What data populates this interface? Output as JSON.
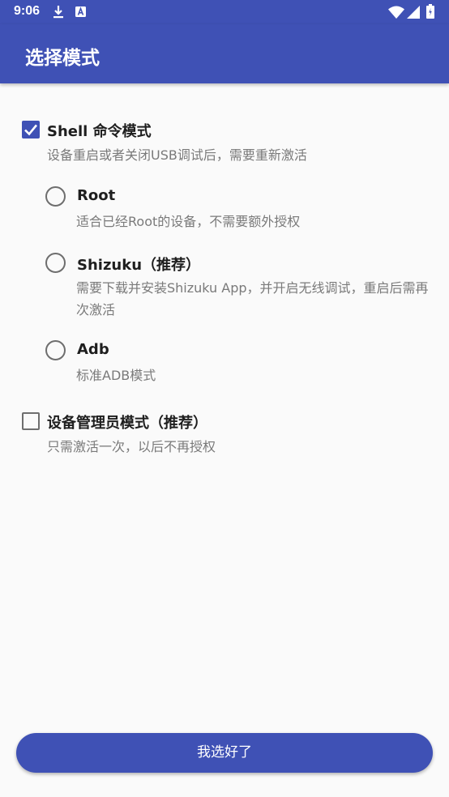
{
  "status_bar": {
    "time": "9:06",
    "icons": [
      "download-icon",
      "a-icon",
      "wifi-icon",
      "signal-icon",
      "battery-icon"
    ]
  },
  "app_bar": {
    "title": "选择模式"
  },
  "shell_mode": {
    "label": "Shell 命令模式",
    "description": "设备重启或者关闭USB调试后，需要重新激活",
    "checked": true,
    "options": [
      {
        "label": "Root",
        "description": "适合已经Root的设备，不需要额外授权",
        "selected": false
      },
      {
        "label": "Shizuku（推荐）",
        "description": "需要下载并安装Shizuku App，并开启无线调试，重启后需再次激活",
        "selected": false
      },
      {
        "label": "Adb",
        "description": "标准ADB模式",
        "selected": false
      }
    ]
  },
  "device_admin_mode": {
    "label": "设备管理员模式（推荐）",
    "description": "只需激活一次，以后不再授权",
    "checked": false
  },
  "confirm_button": {
    "label": "我选好了"
  },
  "colors": {
    "primary": "#3f51b5",
    "background": "#fafafa",
    "description_text": "#7a7a7a"
  }
}
